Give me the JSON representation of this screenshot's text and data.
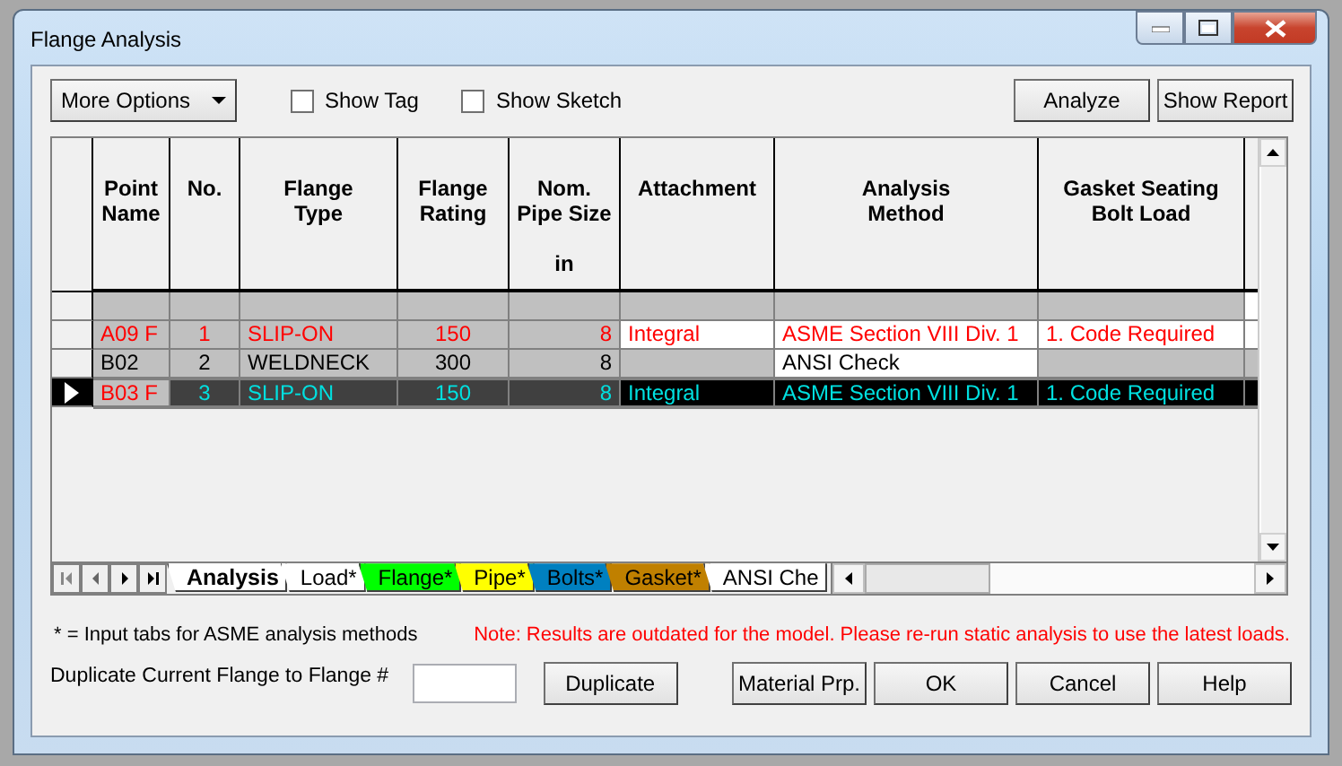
{
  "window": {
    "title": "Flange Analysis"
  },
  "toolbar": {
    "more_options": "More Options",
    "show_tag": {
      "label": "Show Tag",
      "checked": false
    },
    "show_sketch": {
      "label": "Show Sketch",
      "checked": false
    },
    "buttons": [
      "Analyze",
      "Show Report"
    ]
  },
  "table": {
    "columns": [
      {
        "lines": [
          "Point",
          "Name"
        ]
      },
      {
        "lines": [
          "No."
        ]
      },
      {
        "lines": [
          "Flange",
          "Type"
        ]
      },
      {
        "lines": [
          "Flange",
          "Rating"
        ]
      },
      {
        "lines": [
          "Nom.",
          "Pipe Size"
        ],
        "unit": "in"
      },
      {
        "lines": [
          "Attachment"
        ]
      },
      {
        "lines": [
          "Analysis",
          "Method"
        ]
      },
      {
        "lines": [
          "Gasket Seating",
          "Bolt Load"
        ]
      }
    ],
    "rows": [
      {
        "selected": false,
        "cells": [
          {
            "editable": false
          },
          {
            "editable": false
          },
          {
            "editable": false
          },
          {
            "editable": false
          },
          {
            "editable": false
          },
          {
            "editable": false
          },
          {
            "editable": false
          },
          {
            "editable": false
          },
          {
            "editable": true
          }
        ]
      },
      {
        "selected": false,
        "color": "#ff0000",
        "cells": [
          {
            "text": "A09 F",
            "editable": false
          },
          {
            "text": "1",
            "editable": false
          },
          {
            "text": "SLIP-ON",
            "editable": false
          },
          {
            "text": "150",
            "editable": false
          },
          {
            "text": "8",
            "editable": false
          },
          {
            "text": "Integral",
            "editable": true
          },
          {
            "text": "ASME Section VIII Div. 1",
            "editable": true
          },
          {
            "text": "1.   Code Required",
            "editable": true
          },
          {
            "editable": true
          }
        ]
      },
      {
        "selected": false,
        "color": "#000000",
        "cells": [
          {
            "text": "B02",
            "editable": false
          },
          {
            "text": "2",
            "editable": false
          },
          {
            "text": "WELDNECK",
            "editable": false
          },
          {
            "text": "300",
            "editable": false
          },
          {
            "text": "8",
            "editable": false
          },
          {
            "editable": false
          },
          {
            "text": "ANSI Check",
            "editable": true
          },
          {
            "editable": false
          },
          {
            "editable": false
          }
        ]
      },
      {
        "selected": true,
        "color": "#ff0000",
        "cells": [
          {
            "text": "B03 F",
            "editable": false
          },
          {
            "text": "3",
            "editable": false
          },
          {
            "text": "SLIP-ON",
            "editable": false
          },
          {
            "text": "150",
            "editable": false
          },
          {
            "text": "8",
            "editable": false
          },
          {
            "text": "Integral",
            "editable": true
          },
          {
            "text": "ASME Section VIII Div. 1",
            "editable": true
          },
          {
            "text": "1.   Code Required",
            "editable": true
          },
          {
            "editable": true
          }
        ]
      }
    ]
  },
  "tabs": [
    {
      "label": "Analysis",
      "selected": true,
      "color": "#ffffff"
    },
    {
      "label": "Load*",
      "selected": false,
      "color": "#ffffff"
    },
    {
      "label": "Flange*",
      "selected": false,
      "color": "#00ff00"
    },
    {
      "label": "Pipe*",
      "selected": false,
      "color": "#ffff00"
    },
    {
      "label": "Bolts*",
      "selected": false,
      "color": "#0080c0"
    },
    {
      "label": "Gasket*",
      "selected": false,
      "color": "#c08000"
    },
    {
      "label": "ANSI Che",
      "selected": false,
      "color": "#ffffff"
    }
  ],
  "legend": "* = Input tabs for ASME analysis methods",
  "note": "Note: Results are outdated for the model. Please re-run static analysis to use the latest loads.",
  "duplicate": {
    "label": "Duplicate Current Flange to Flange #",
    "button": "Duplicate"
  },
  "buttons": [
    "Material Prp.",
    "OK",
    "Cancel",
    "Help"
  ]
}
